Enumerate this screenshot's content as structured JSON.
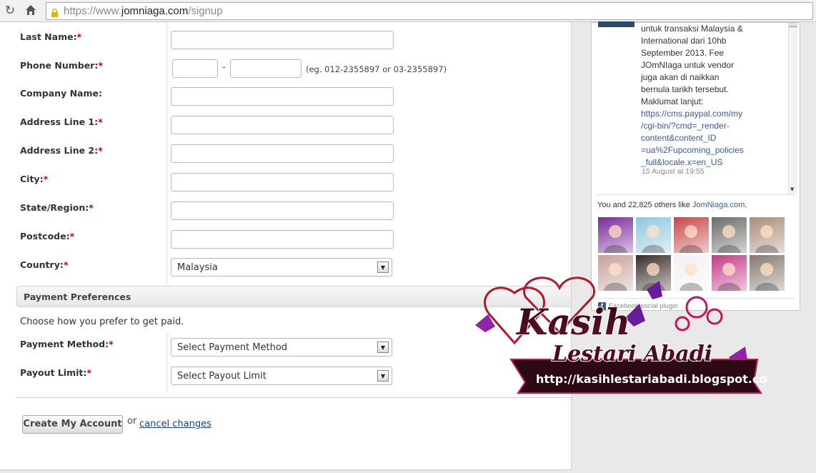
{
  "browser": {
    "url_prefix": "https://www.",
    "url_domain": "jomniaga.com",
    "url_path": "/signup"
  },
  "form": {
    "fields": [
      {
        "label": "Last Name:",
        "required": true,
        "type": "text",
        "value": ""
      },
      {
        "label": "Phone Number:",
        "required": true,
        "type": "phone",
        "value": ""
      },
      {
        "label": "Company Name:",
        "required": false,
        "type": "text",
        "value": ""
      },
      {
        "label": "Address Line 1:",
        "required": true,
        "type": "text",
        "value": ""
      },
      {
        "label": "Address Line 2:",
        "required": true,
        "type": "text",
        "value": ""
      },
      {
        "label": "City:",
        "required": true,
        "type": "text",
        "value": ""
      },
      {
        "label": "State/Region:",
        "required": true,
        "type": "text",
        "value": ""
      },
      {
        "label": "Postcode:",
        "required": true,
        "type": "text",
        "value": ""
      },
      {
        "label": "Country:",
        "required": true,
        "type": "select",
        "value": "Malaysia"
      }
    ],
    "phone_separator": "-",
    "phone_hint": "(eg. 012-2355897 or 03-2355897)",
    "required_mark": "*"
  },
  "payment": {
    "heading": "Payment Preferences",
    "instruction": "Choose how you prefer to get paid.",
    "method_label": "Payment Method:",
    "method_value": "Select Payment Method",
    "limit_label": "Payout Limit:",
    "limit_value": "Select Payout Limit"
  },
  "actions": {
    "create_label": "Create My Account",
    "or_text": "or",
    "cancel_label": "cancel changes"
  },
  "facebook": {
    "post_lines": [
      "untuk transaksi Malaysia &",
      "International dari 10hb",
      "September 2013. Fee",
      "JOmNIaga untuk vendor",
      "juga akan di naikkan",
      "bernula tarikh tersebut.",
      "Maklumat lanjut:"
    ],
    "post_link_lines": [
      "https://cms.paypal.com/my",
      "/cgi-bin/?cmd=_render-",
      "content&content_ID",
      "=ua%2Fupcoming_policies",
      "_full&locale.x=en_US"
    ],
    "timestamp": "15 August at 19:55",
    "likes_prefix": "You and 22,825 others like ",
    "likes_page": "JomNiaga.com",
    "likes_suffix": ".",
    "plugin_text": "Facebook social plugin",
    "faces": [
      {
        "color": "#7a2a9a"
      },
      {
        "color": "#8fc7df"
      },
      {
        "color": "#c8484a"
      },
      {
        "color": "#6b6b68"
      },
      {
        "color": "#a98c7a"
      },
      {
        "color": "#c7a19a"
      },
      {
        "color": "#3a2e2a"
      },
      {
        "color": "#f2f2f2"
      },
      {
        "color": "#c23c8a"
      },
      {
        "color": "#86796e"
      }
    ]
  },
  "watermark": {
    "title": "Kasih",
    "subtitle": "Lestari Abadi",
    "url": "http://kasihlestariabadi.blogspot.com"
  }
}
